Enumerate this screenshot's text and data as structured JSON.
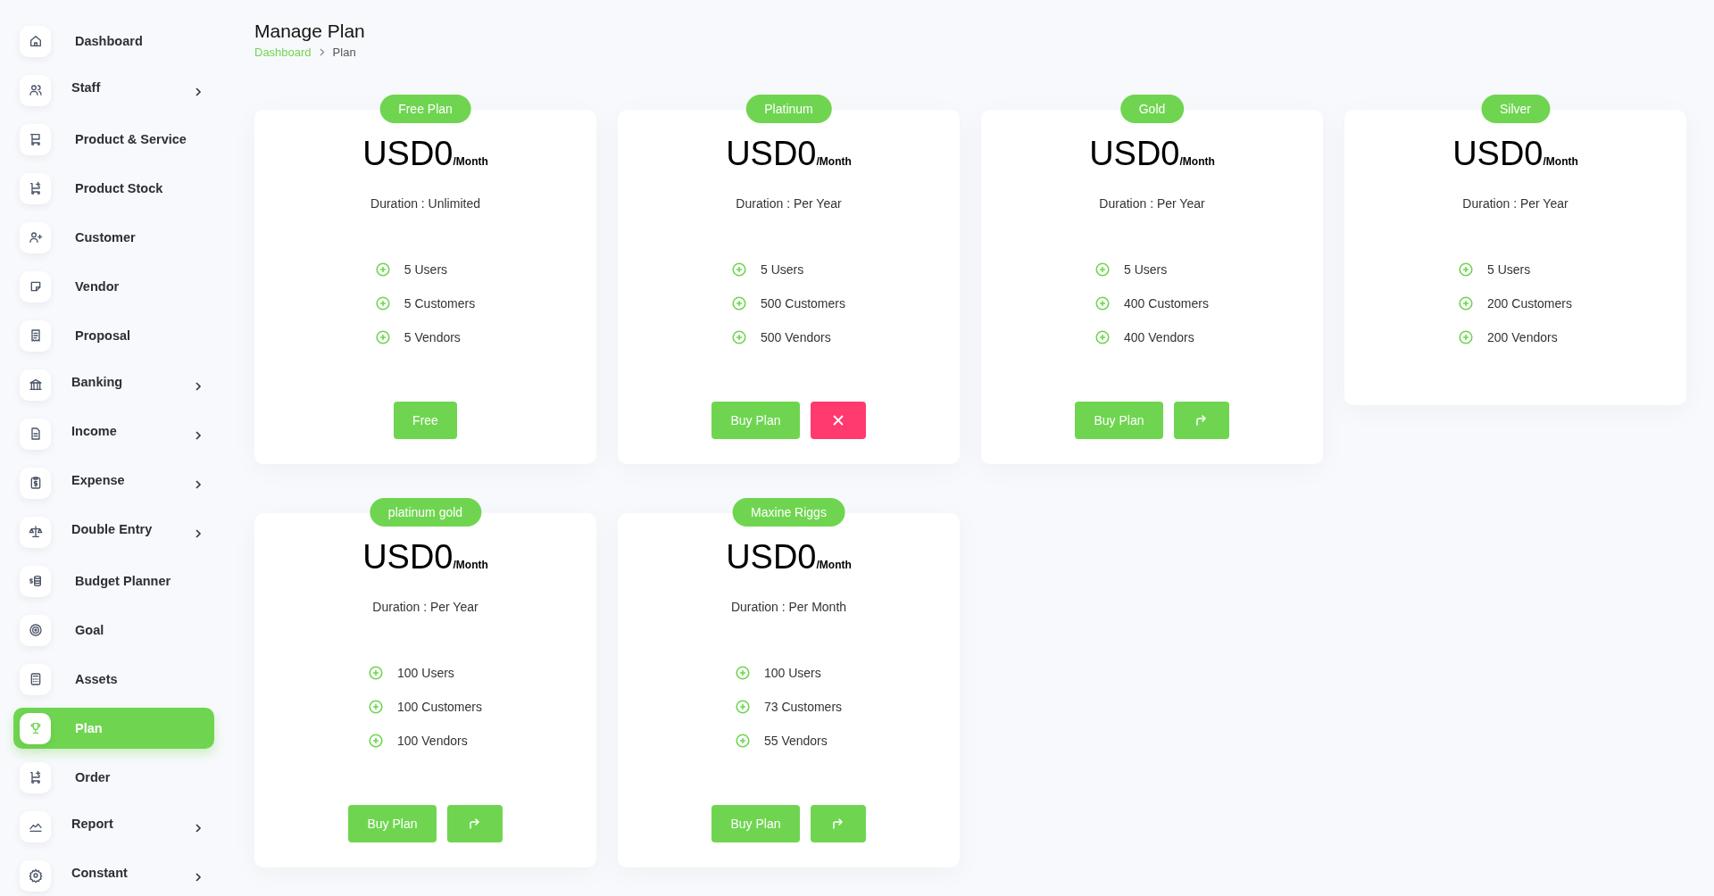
{
  "sidebar": {
    "items": [
      {
        "label": "Dashboard",
        "has_submenu": false,
        "selected": false
      },
      {
        "label": "Staff",
        "has_submenu": true,
        "selected": false
      },
      {
        "label": "Product & Service",
        "has_submenu": false,
        "selected": false
      },
      {
        "label": "Product Stock",
        "has_submenu": false,
        "selected": false
      },
      {
        "label": "Customer",
        "has_submenu": false,
        "selected": false
      },
      {
        "label": "Vendor",
        "has_submenu": false,
        "selected": false
      },
      {
        "label": "Proposal",
        "has_submenu": false,
        "selected": false
      },
      {
        "label": "Banking",
        "has_submenu": true,
        "selected": false
      },
      {
        "label": "Income",
        "has_submenu": true,
        "selected": false
      },
      {
        "label": "Expense",
        "has_submenu": true,
        "selected": false
      },
      {
        "label": "Double Entry",
        "has_submenu": true,
        "selected": false
      },
      {
        "label": "Budget Planner",
        "has_submenu": false,
        "selected": false
      },
      {
        "label": "Goal",
        "has_submenu": false,
        "selected": false
      },
      {
        "label": "Assets",
        "has_submenu": false,
        "selected": false
      },
      {
        "label": "Plan",
        "has_submenu": false,
        "selected": true
      },
      {
        "label": "Order",
        "has_submenu": false,
        "selected": false
      },
      {
        "label": "Report",
        "has_submenu": true,
        "selected": false
      },
      {
        "label": "Constant",
        "has_submenu": true,
        "selected": false
      }
    ]
  },
  "page": {
    "title": "Manage Plan",
    "breadcrumb": [
      "Dashboard",
      "Plan"
    ]
  },
  "plans": [
    {
      "name": "Free Plan",
      "price": "USD0",
      "period": "/Month",
      "duration": "Duration : Unlimited",
      "features": [
        "5 Users",
        "5 Customers",
        "5 Vendors"
      ],
      "actions": [
        {
          "kind": "text",
          "label": "Free"
        }
      ]
    },
    {
      "name": "Platinum",
      "price": "USD0",
      "period": "/Month",
      "duration": "Duration : Per Year",
      "features": [
        "5 Users",
        "500 Customers",
        "500 Vendors"
      ],
      "actions": [
        {
          "kind": "text",
          "label": "Buy Plan"
        },
        {
          "kind": "cancel"
        }
      ]
    },
    {
      "name": "Gold",
      "price": "USD0",
      "period": "/Month",
      "duration": "Duration : Per Year",
      "features": [
        "5 Users",
        "400 Customers",
        "400 Vendors"
      ],
      "actions": [
        {
          "kind": "text",
          "label": "Buy Plan"
        },
        {
          "kind": "redirect"
        }
      ]
    },
    {
      "name": "Silver",
      "price": "USD0",
      "period": "/Month",
      "duration": "Duration : Per Year",
      "features": [
        "5 Users",
        "200 Customers",
        "200 Vendors"
      ]
    },
    {
      "name": "platinum gold",
      "price": "USD0",
      "period": "/Month",
      "duration": "Duration : Per Year",
      "features": [
        "100 Users",
        "100 Customers",
        "100 Vendors"
      ],
      "actions": [
        {
          "kind": "text",
          "label": "Buy Plan"
        },
        {
          "kind": "redirect"
        }
      ]
    },
    {
      "name": "Maxine Riggs",
      "price": "USD0",
      "period": "/Month",
      "duration": "Duration : Per Month",
      "features": [
        "100 Users",
        "73 Customers",
        "55 Vendors"
      ],
      "actions": [
        {
          "kind": "text",
          "label": "Buy Plan"
        },
        {
          "kind": "redirect"
        }
      ]
    }
  ]
}
